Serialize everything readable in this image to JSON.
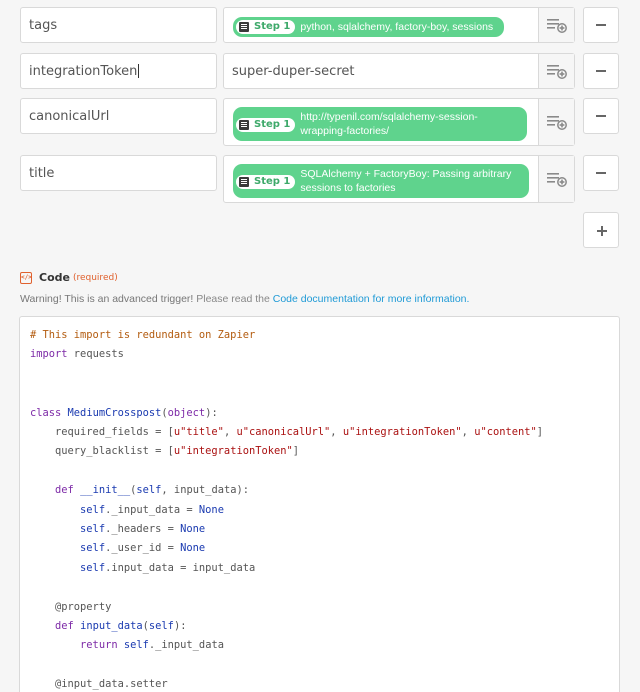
{
  "rows": [
    {
      "key": "tags",
      "value_type": "step",
      "step_label": "Step 1",
      "pill_text": "python, sqlalchemy, factory-boy, sessions"
    },
    {
      "key": "integrationToken",
      "value_type": "text",
      "value": "super-duper-secret"
    },
    {
      "key": "canonicalUrl",
      "value_type": "step",
      "step_label": "Step 1",
      "pill_text": "http://typenil.com/sqlalchemy-session-wrapping-factories/"
    },
    {
      "key": "title",
      "value_type": "step",
      "step_label": "Step 1",
      "pill_text": "SQLAlchemy + FactoryBoy: Passing arbitrary sessions to factories"
    }
  ],
  "icons": {
    "insert": "insert-field-icon",
    "remove": "minus-icon",
    "add": "plus-icon",
    "code": "code-icon",
    "step": "step-icon"
  },
  "code_section": {
    "title": "Code",
    "required": "(required)",
    "warning_bold": "Warning! This is an advanced trigger!",
    "warning_text": " Please read the ",
    "warning_link": "Code documentation for more information."
  },
  "code_lines": [
    {
      "tokens": [
        {
          "t": "comment",
          "v": "# This import is redundant on Zapier"
        }
      ]
    },
    {
      "tokens": [
        {
          "t": "kw",
          "v": "import"
        },
        {
          "t": "plain",
          "v": " requests"
        }
      ]
    },
    {
      "tokens": []
    },
    {
      "tokens": []
    },
    {
      "tokens": [
        {
          "t": "kw",
          "v": "class"
        },
        {
          "t": "plain",
          "v": " "
        },
        {
          "t": "cls",
          "v": "MediumCrosspost"
        },
        {
          "t": "plain",
          "v": "("
        },
        {
          "t": "kw",
          "v": "object"
        },
        {
          "t": "plain",
          "v": "):"
        }
      ]
    },
    {
      "tokens": [
        {
          "t": "plain",
          "v": "    required_fields = ["
        },
        {
          "t": "str",
          "v": "u\"title\""
        },
        {
          "t": "plain",
          "v": ", "
        },
        {
          "t": "str",
          "v": "u\"canonicalUrl\""
        },
        {
          "t": "plain",
          "v": ", "
        },
        {
          "t": "str",
          "v": "u\"integrationToken\""
        },
        {
          "t": "plain",
          "v": ", "
        },
        {
          "t": "str",
          "v": "u\"content\""
        },
        {
          "t": "plain",
          "v": "]"
        }
      ]
    },
    {
      "tokens": [
        {
          "t": "plain",
          "v": "    query_blacklist = ["
        },
        {
          "t": "str",
          "v": "u\"integrationToken\""
        },
        {
          "t": "plain",
          "v": "]"
        }
      ]
    },
    {
      "tokens": []
    },
    {
      "tokens": [
        {
          "t": "plain",
          "v": "    "
        },
        {
          "t": "kw",
          "v": "def"
        },
        {
          "t": "plain",
          "v": " "
        },
        {
          "t": "def",
          "v": "__init__"
        },
        {
          "t": "plain",
          "v": "("
        },
        {
          "t": "self",
          "v": "self"
        },
        {
          "t": "plain",
          "v": ", input_data):"
        }
      ]
    },
    {
      "tokens": [
        {
          "t": "plain",
          "v": "        "
        },
        {
          "t": "self",
          "v": "self"
        },
        {
          "t": "plain",
          "v": "._input_data = "
        },
        {
          "t": "none",
          "v": "None"
        }
      ]
    },
    {
      "tokens": [
        {
          "t": "plain",
          "v": "        "
        },
        {
          "t": "self",
          "v": "self"
        },
        {
          "t": "plain",
          "v": "._headers = "
        },
        {
          "t": "none",
          "v": "None"
        }
      ]
    },
    {
      "tokens": [
        {
          "t": "plain",
          "v": "        "
        },
        {
          "t": "self",
          "v": "self"
        },
        {
          "t": "plain",
          "v": "._user_id = "
        },
        {
          "t": "none",
          "v": "None"
        }
      ]
    },
    {
      "tokens": [
        {
          "t": "plain",
          "v": "        "
        },
        {
          "t": "self",
          "v": "self"
        },
        {
          "t": "plain",
          "v": ".input_data = input_data"
        }
      ]
    },
    {
      "tokens": []
    },
    {
      "tokens": [
        {
          "t": "dec",
          "v": "    @property"
        }
      ]
    },
    {
      "tokens": [
        {
          "t": "plain",
          "v": "    "
        },
        {
          "t": "kw",
          "v": "def"
        },
        {
          "t": "plain",
          "v": " "
        },
        {
          "t": "def",
          "v": "input_data"
        },
        {
          "t": "plain",
          "v": "("
        },
        {
          "t": "self",
          "v": "self"
        },
        {
          "t": "plain",
          "v": "):"
        }
      ]
    },
    {
      "tokens": [
        {
          "t": "plain",
          "v": "        "
        },
        {
          "t": "kw",
          "v": "return"
        },
        {
          "t": "plain",
          "v": " "
        },
        {
          "t": "self",
          "v": "self"
        },
        {
          "t": "plain",
          "v": "._input_data"
        }
      ]
    },
    {
      "tokens": []
    },
    {
      "tokens": [
        {
          "t": "dec",
          "v": "    @input_data.setter"
        }
      ]
    }
  ]
}
